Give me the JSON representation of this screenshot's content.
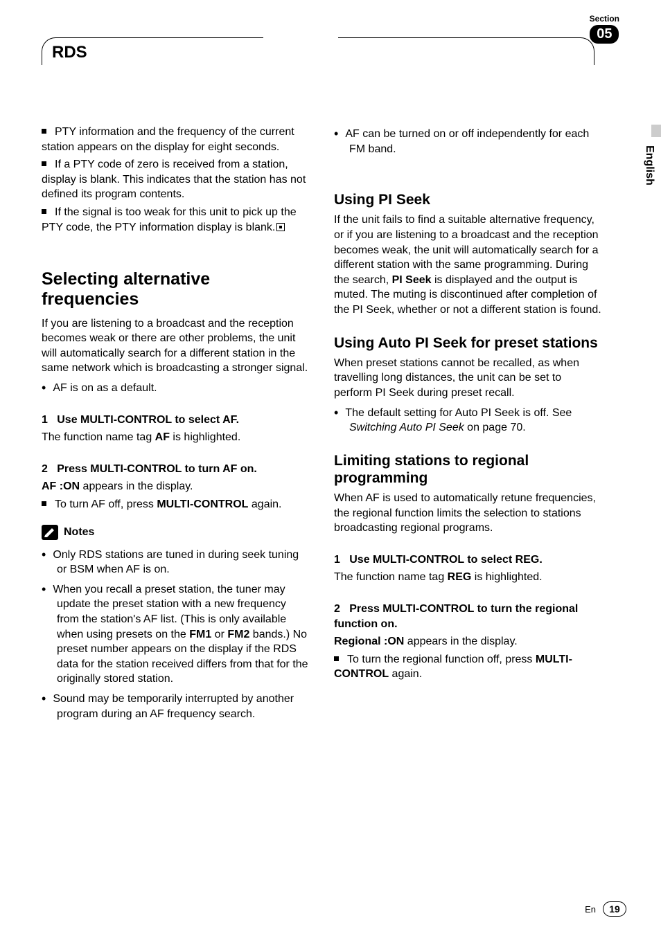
{
  "header": {
    "title": "RDS",
    "section_label": "Section",
    "section_number": "05"
  },
  "sidebar": {
    "language": "English"
  },
  "col1": {
    "intro": {
      "b1": "PTY information and the frequency of the current station appears on the display for eight seconds.",
      "b2": "If a PTY code of zero is received from a station, display is blank. This indicates that the station has not defined its program contents.",
      "b3": "If the signal is too weak for this unit to pick up the PTY code, the PTY information display is blank."
    },
    "h1": "Selecting alternative frequencies",
    "p1": "If you are listening to a broadcast and the reception becomes weak or there are other problems, the unit will automatically search for a different station in the same network which is broadcasting a stronger signal.",
    "p1b": "AF is on as a default.",
    "step1": {
      "num": "1",
      "title": "Use MULTI-CONTROL to select AF.",
      "body_a": "The function name tag ",
      "body_b": "AF",
      "body_c": " is highlighted."
    },
    "step2": {
      "num": "2",
      "title": "Press MULTI-CONTROL to turn AF on.",
      "body_a": "AF :ON",
      "body_b": " appears in the display.",
      "sub_a": "To turn AF off, press ",
      "sub_b": "MULTI-CONTROL",
      "sub_c": " again."
    },
    "notes_label": "Notes",
    "notes": {
      "n1": "Only RDS stations are tuned in during seek tuning or BSM when AF is on.",
      "n2a": "When you recall a preset station, the tuner may update the preset station with a new frequency from the station's AF list. (This is only available when using presets on the ",
      "n2b": "FM1",
      "n2c": " or ",
      "n2d": "FM2",
      "n2e": " bands.) No preset number appears on the display if the RDS data for the station received differs from that for the originally stored station.",
      "n3": "Sound may be temporarily interrupted by another program during an AF frequency search."
    }
  },
  "col2": {
    "top_b": "AF can be turned on or off independently for each FM band.",
    "sec1": {
      "h": "Using PI Seek",
      "p_a": "If the unit fails to find a suitable alternative frequency, or if you are listening to a broadcast and the reception becomes weak, the unit will automatically search for a different station with the same programming. During the search, ",
      "p_b": "PI Seek",
      "p_c": " is displayed and the output is muted. The muting is discontinued after completion of the PI Seek, whether or not a different station is found."
    },
    "sec2": {
      "h": "Using Auto PI Seek for preset stations",
      "p": "When preset stations cannot be recalled, as when travelling long distances, the unit can be set to perform PI Seek during preset recall.",
      "b_a": "The default setting for Auto PI Seek is off. See ",
      "b_i": "Switching Auto PI Seek",
      "b_b": " on page 70."
    },
    "sec3": {
      "h": "Limiting stations to regional programming",
      "p": "When AF is used to automatically retune frequencies, the regional function limits the selection to stations broadcasting regional programs.",
      "step1": {
        "num": "1",
        "title": "Use MULTI-CONTROL to select REG.",
        "body_a": "The function name tag ",
        "body_b": "REG",
        "body_c": " is highlighted."
      },
      "step2": {
        "num": "2",
        "title": "Press MULTI-CONTROL to turn the regional function on.",
        "body_a": "Regional :ON",
        "body_b": " appears in the display.",
        "sub_a": "To turn the regional function off, press ",
        "sub_b": "MULTI-CONTROL",
        "sub_c": " again."
      }
    }
  },
  "footer": {
    "lang_abbr": "En",
    "page": "19"
  }
}
